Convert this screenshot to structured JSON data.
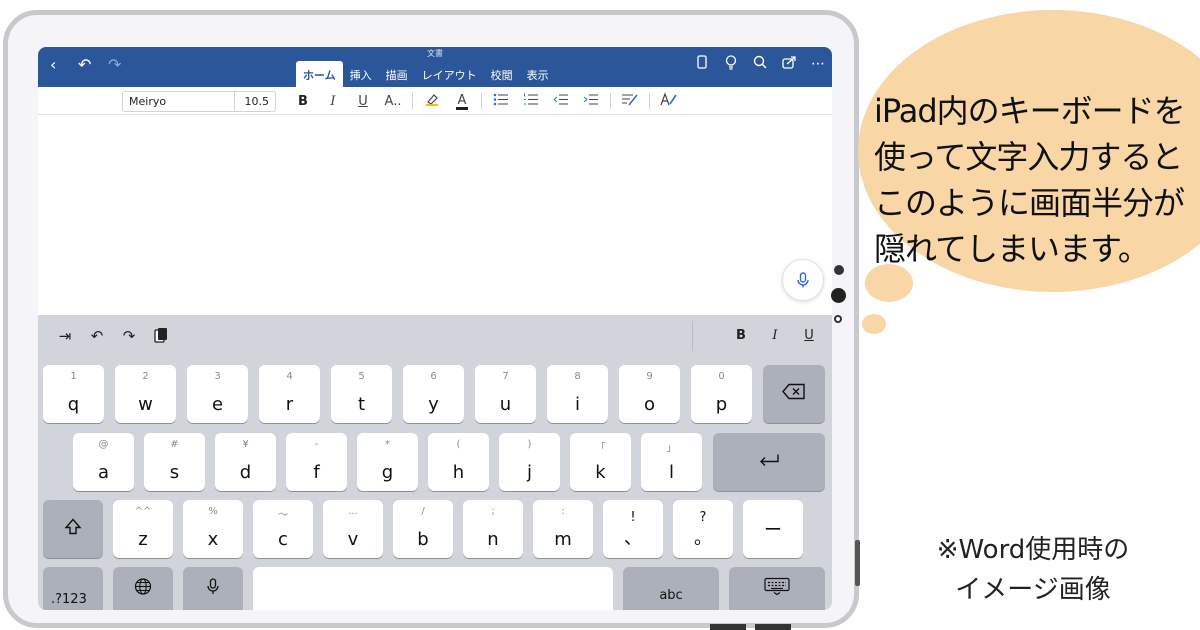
{
  "word": {
    "doc_title": "文書",
    "tabs": [
      "ホーム",
      "挿入",
      "描画",
      "レイアウト",
      "校閲",
      "表示"
    ],
    "active_tab": "ホーム"
  },
  "format": {
    "font_name": "Meiryo",
    "font_size": "10.5",
    "bold": "B",
    "italic": "I",
    "underline": "U",
    "text_effects": "A..",
    "font_color": "A"
  },
  "keyboard": {
    "shortcuts_format": {
      "bold": "B",
      "italic": "I",
      "underline": "U"
    },
    "row1": [
      {
        "hint": "1",
        "label": "q"
      },
      {
        "hint": "2",
        "label": "w"
      },
      {
        "hint": "3",
        "label": "e"
      },
      {
        "hint": "4",
        "label": "r"
      },
      {
        "hint": "5",
        "label": "t"
      },
      {
        "hint": "6",
        "label": "y"
      },
      {
        "hint": "7",
        "label": "u"
      },
      {
        "hint": "8",
        "label": "i"
      },
      {
        "hint": "9",
        "label": "o"
      },
      {
        "hint": "0",
        "label": "p"
      }
    ],
    "row2": [
      {
        "hint": "@",
        "label": "a"
      },
      {
        "hint": "#",
        "label": "s"
      },
      {
        "hint": "¥",
        "label": "d"
      },
      {
        "hint": "-",
        "label": "f"
      },
      {
        "hint": "*",
        "label": "g"
      },
      {
        "hint": "(",
        "label": "h"
      },
      {
        "hint": ")",
        "label": "j"
      },
      {
        "hint": "「",
        "label": "k"
      },
      {
        "hint": "」",
        "label": "l"
      }
    ],
    "row3": [
      {
        "hint": "^^",
        "label": "z"
      },
      {
        "hint": "%",
        "label": "x"
      },
      {
        "hint": "〜",
        "label": "c"
      },
      {
        "hint": "...",
        "label": "v"
      },
      {
        "hint": "/",
        "label": "b"
      },
      {
        "hint": ";",
        "label": "n"
      },
      {
        "hint": ":",
        "label": "m"
      },
      {
        "hint": "!",
        "label": "、"
      },
      {
        "hint": "?",
        "label": "。"
      }
    ],
    "dash": "ー",
    "numbers_key": ".?123",
    "abc_key": "abc"
  },
  "annotation": {
    "bubble_text": "iPad内のキーボードを\n使って文字入力すると\nこのように画面半分が\n隠れてしまいます。",
    "note": "※Word使用時の\nイメージ画像"
  },
  "colors": {
    "word_blue": "#2b579a",
    "bubble": "#f8d6a6",
    "keyboard_bg": "#d2d4db"
  }
}
